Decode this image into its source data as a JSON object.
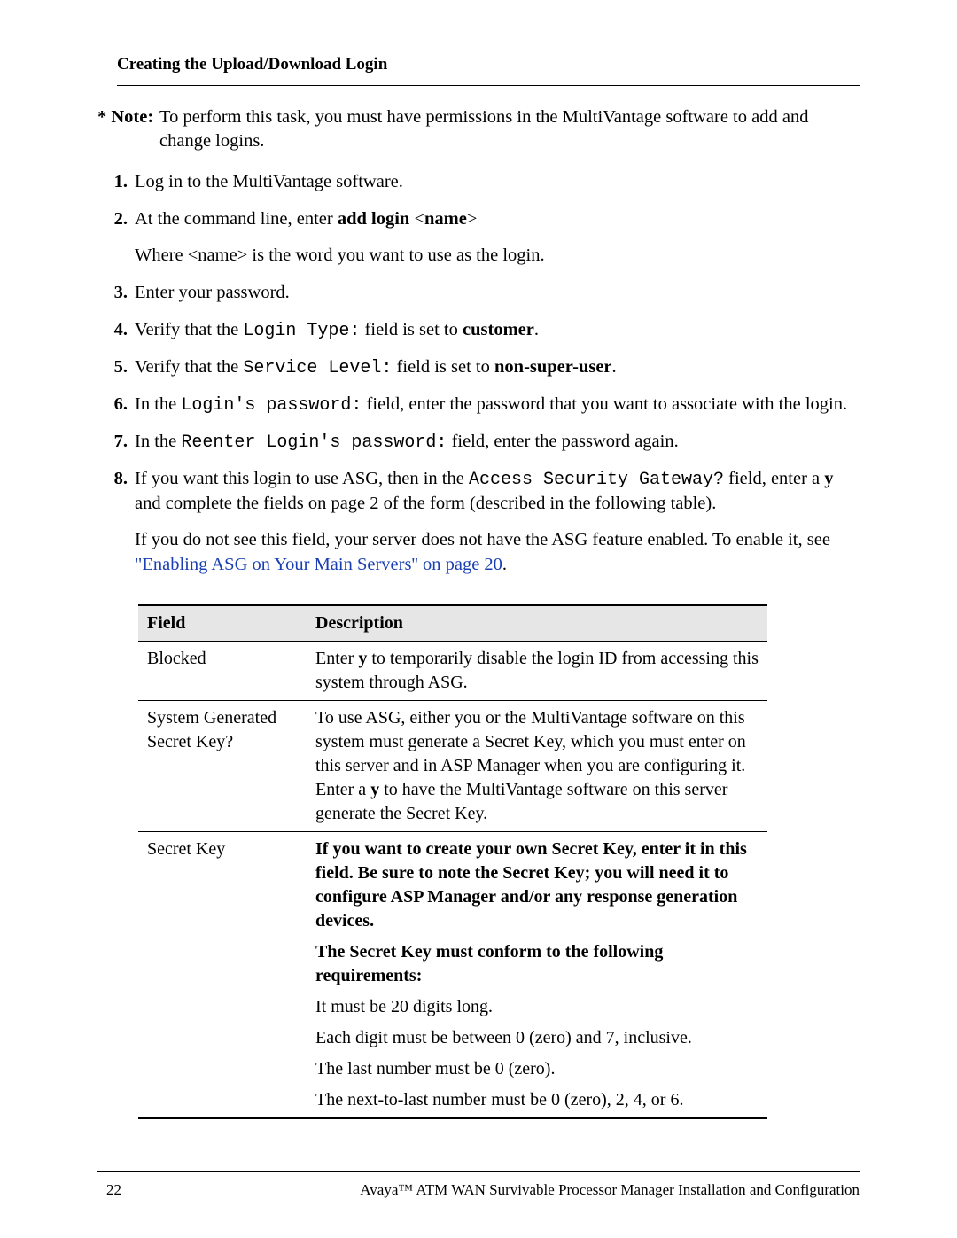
{
  "header": "Creating the Upload/Download Login",
  "note": {
    "label": "* Note:",
    "text": "To perform this task, you must have permissions in the MultiVantage software to add and change logins."
  },
  "steps": {
    "s1": {
      "num": "1.",
      "text": "Log in to the MultiVantage software."
    },
    "s2": {
      "num": "2.",
      "pre": "At the command line, enter ",
      "cmd": "add login",
      "arg": "<name>",
      "sub": "Where <name> is the word you want to use as the login."
    },
    "s3": {
      "num": "3.",
      "text": "Enter your password."
    },
    "s4": {
      "num": "4.",
      "pre": "Verify that the ",
      "mono": "Login Type:",
      "mid": " field is set to ",
      "bold": "customer",
      "post": "."
    },
    "s5": {
      "num": "5.",
      "pre": "Verify that the ",
      "mono": "Service Level:",
      "mid": " field is set to ",
      "bold": "non-super-user",
      "post": "."
    },
    "s6": {
      "num": "6.",
      "pre": "In the ",
      "mono": "Login's password:",
      "post": " field, enter the password that you want to associate with the login."
    },
    "s7": {
      "num": "7.",
      "pre": "In the ",
      "mono": "Reenter Login's password:",
      "post": " field, enter the password again."
    },
    "s8": {
      "num": "8.",
      "p1a": "If you want this login to use ASG, then in the ",
      "p1mono": "Access Security Gateway?",
      "p1b": " field, enter a ",
      "p1bold": "y",
      "p1c": " and complete the fields on page 2 of the form (described in the following table).",
      "p2a": "If you do not see this field, your server does not have the ASG feature enabled. To enable it, see ",
      "p2link": "\"Enabling ASG on Your Main Servers'' on page 20",
      "p2b": "."
    }
  },
  "table": {
    "h1": "Field",
    "h2": "Description",
    "r1f": "Blocked",
    "r1a": "Enter ",
    "r1b": "y",
    "r1c": " to temporarily disable the login ID from accessing this system through ASG.",
    "r2f": "System Generated Secret Key?",
    "r2a": "To use ASG, either you or the MultiVantage software on this system must generate a Secret Key, which you must enter on this server and in ASP Manager when you are configuring it. Enter a ",
    "r2b": "y",
    "r2c": " to have the MultiVantage software on this server generate the Secret Key.",
    "r3f": "Secret Key",
    "r3p1": "If you want to create your own Secret Key, enter it in this field. Be sure to note the Secret Key; you will need it to configure ASP Manager and/or any response generation devices.",
    "r3p2": "The Secret Key must conform to the following requirements:",
    "r3p3": "It must be 20 digits long.",
    "r3p4": "Each digit must be between 0 (zero) and 7, inclusive.",
    "r3p5": "The last number must be 0 (zero).",
    "r3p6": "The next-to-last number must be 0 (zero), 2, 4, or 6."
  },
  "footer": {
    "page": "22",
    "title": "Avaya™ ATM WAN Survivable Processor Manager Installation and Configuration"
  }
}
